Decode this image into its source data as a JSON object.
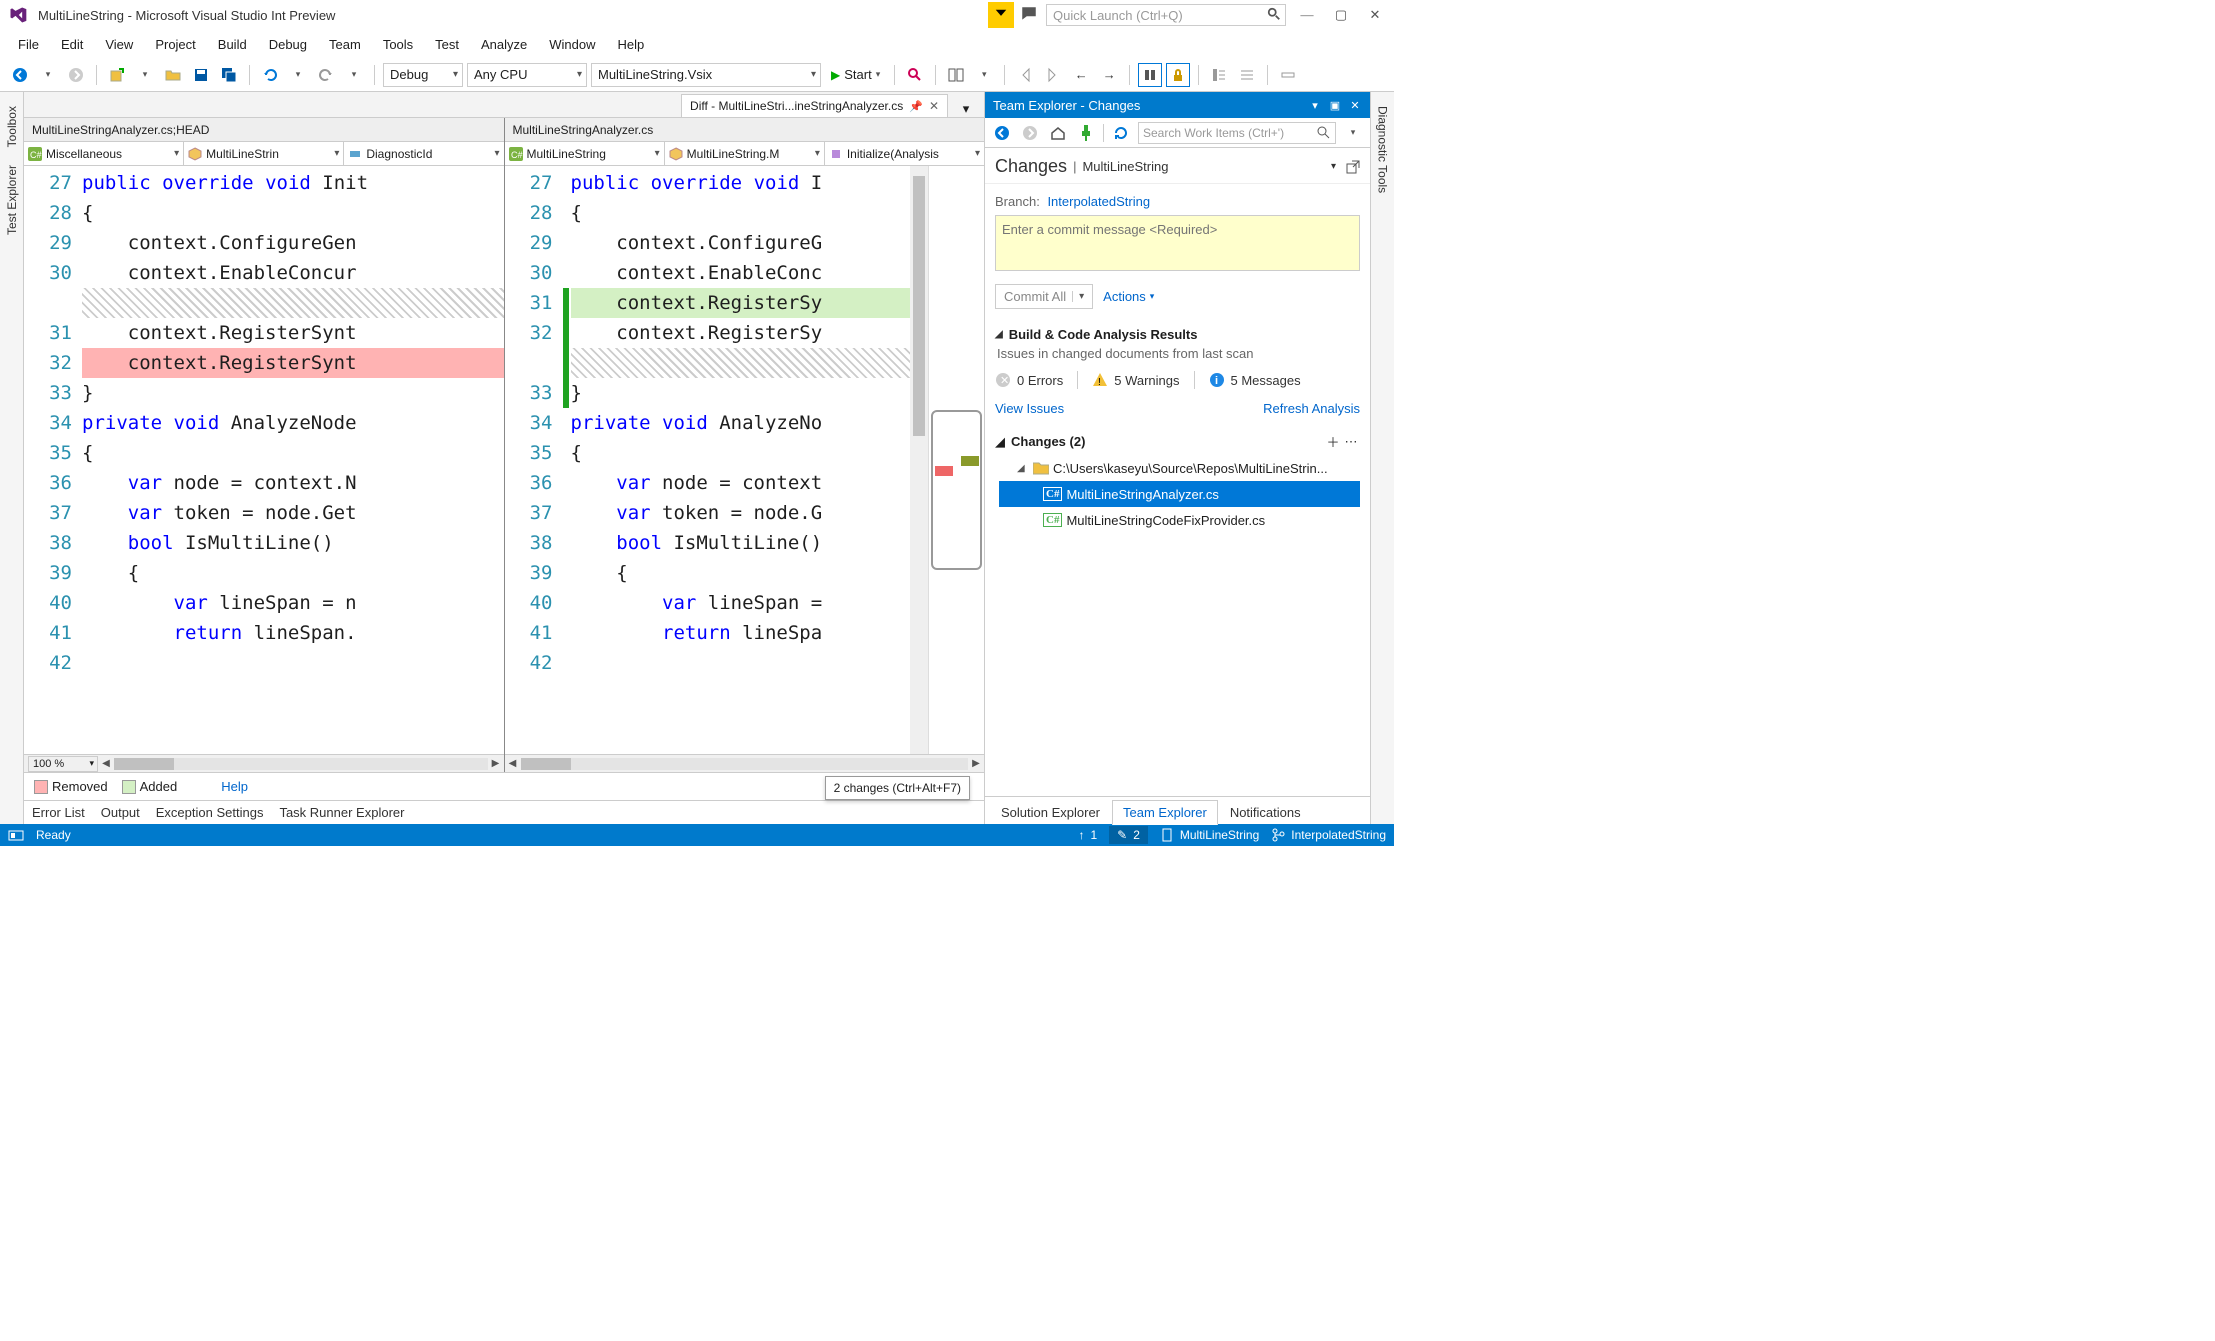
{
  "titlebar": {
    "title": "MultiLineString - Microsoft Visual Studio Int Preview",
    "quick_launch_placeholder": "Quick Launch (Ctrl+Q)"
  },
  "menu": [
    "File",
    "Edit",
    "View",
    "Project",
    "Build",
    "Debug",
    "Team",
    "Tools",
    "Test",
    "Analyze",
    "Window",
    "Help"
  ],
  "toolbar": {
    "config": "Debug",
    "platform": "Any CPU",
    "startup": "MultiLineString.Vsix",
    "start": "Start"
  },
  "doc_tab": {
    "label": "Diff - MultiLineStri...ineStringAnalyzer.cs"
  },
  "left_pane": {
    "header": "MultiLineStringAnalyzer.cs;HEAD",
    "nav": [
      "Miscellaneous",
      "MultiLineStrin",
      "DiagnosticId"
    ],
    "lines": [
      {
        "n": 27,
        "text": "public override void Init",
        "kw": [
          "public",
          "override",
          "void"
        ]
      },
      {
        "n": 28,
        "text": "{"
      },
      {
        "n": 29,
        "text": "    context.ConfigureGen"
      },
      {
        "n": 30,
        "text": "    context.EnableConcur"
      },
      {
        "n": 0,
        "hatch": true
      },
      {
        "n": 31,
        "text": "    context.RegisterSynt"
      },
      {
        "n": 32,
        "text": "    context.RegisterSynt",
        "removed": true
      },
      {
        "n": 33,
        "text": "}"
      },
      {
        "n": 34,
        "text": ""
      },
      {
        "n": 35,
        "text": "private void AnalyzeNode",
        "kw": [
          "private",
          "void"
        ]
      },
      {
        "n": 36,
        "text": "{"
      },
      {
        "n": 37,
        "text": "    var node = context.N",
        "kw": [
          "var"
        ]
      },
      {
        "n": 38,
        "text": "    var token = node.Get",
        "kw": [
          "var"
        ]
      },
      {
        "n": 39,
        "text": "    bool IsMultiLine()",
        "kw": [
          "bool"
        ]
      },
      {
        "n": 40,
        "text": "    {"
      },
      {
        "n": 41,
        "text": "        var lineSpan = n",
        "kw": [
          "var"
        ]
      },
      {
        "n": 42,
        "text": "        return lineSpan.",
        "kw": [
          "return"
        ]
      }
    ]
  },
  "right_pane": {
    "header": "MultiLineStringAnalyzer.cs",
    "nav": [
      "MultiLineString",
      "MultiLineString.M",
      "Initialize(Analysis"
    ],
    "lines": [
      {
        "n": 27,
        "text": "public override void I",
        "kw": [
          "public",
          "override",
          "void"
        ]
      },
      {
        "n": 28,
        "text": "{"
      },
      {
        "n": 29,
        "text": "    context.ConfigureG"
      },
      {
        "n": 30,
        "text": "    context.EnableConc"
      },
      {
        "n": 31,
        "text": "    context.RegisterSy",
        "added": true
      },
      {
        "n": 32,
        "text": "    context.RegisterSy"
      },
      {
        "n": 0,
        "hatch": true
      },
      {
        "n": 33,
        "text": "}"
      },
      {
        "n": 34,
        "text": ""
      },
      {
        "n": 35,
        "text": "private void AnalyzeNo",
        "kw": [
          "private",
          "void"
        ]
      },
      {
        "n": 36,
        "text": "{"
      },
      {
        "n": 37,
        "text": "    var node = context",
        "kw": [
          "var"
        ]
      },
      {
        "n": 38,
        "text": "    var token = node.G",
        "kw": [
          "var"
        ]
      },
      {
        "n": 39,
        "text": "    bool IsMultiLine()",
        "kw": [
          "bool"
        ]
      },
      {
        "n": 40,
        "text": "    {"
      },
      {
        "n": 41,
        "text": "        var lineSpan =",
        "kw": [
          "var"
        ]
      },
      {
        "n": 42,
        "text": "        return lineSpa",
        "kw": [
          "return"
        ]
      }
    ]
  },
  "zoom": "100 %",
  "legend": {
    "removed": "Removed",
    "added": "Added",
    "help": "Help"
  },
  "bottom_tabs": [
    "Error List",
    "Output",
    "Exception Settings",
    "Task Runner Explorer"
  ],
  "changes_popup": "2 changes (Ctrl+Alt+F7)",
  "team_explorer": {
    "title": "Team Explorer - Changes",
    "search_placeholder": "Search Work Items (Ctrl+')",
    "header": {
      "changes": "Changes",
      "project": "MultiLineString"
    },
    "branch": {
      "label": "Branch:",
      "value": "InterpolatedString"
    },
    "commit_placeholder": "Enter a commit message <Required>",
    "commit_button": "Commit All",
    "actions": "Actions",
    "analysis": {
      "title": "Build & Code Analysis Results",
      "subtitle": "Issues in changed documents from last scan",
      "errors": "0 Errors",
      "warnings": "5 Warnings",
      "messages": "5 Messages",
      "view": "View Issues",
      "refresh": "Refresh Analysis"
    },
    "changes_section": {
      "title": "Changes (2)",
      "folder": "C:\\Users\\kaseyu\\Source\\Repos\\MultiLineStrin...",
      "files": [
        "MultiLineStringAnalyzer.cs",
        "MultiLineStringCodeFixProvider.cs"
      ]
    },
    "bottom_tabs": [
      "Solution Explorer",
      "Team Explorer",
      "Notifications"
    ]
  },
  "left_tabs": [
    "Toolbox",
    "Test Explorer"
  ],
  "right_tabs": [
    "Diagnostic Tools"
  ],
  "statusbar": {
    "ready": "Ready",
    "up": "1",
    "pencil": "2",
    "project": "MultiLineString",
    "branch": "InterpolatedString"
  }
}
